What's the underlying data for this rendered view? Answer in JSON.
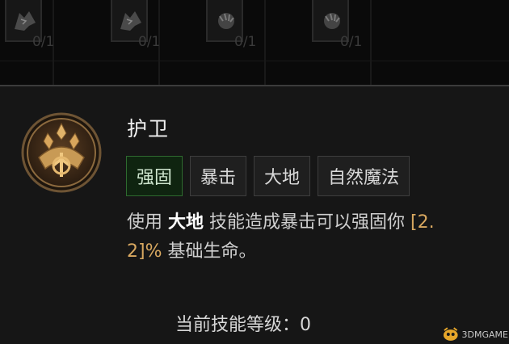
{
  "skill_bar": {
    "slots": [
      {
        "icon": "wolf-head-icon",
        "count": "0/1"
      },
      {
        "icon": "wolf-head-icon",
        "count": "0/1"
      },
      {
        "icon": "beast-claw-icon",
        "count": "0/1"
      },
      {
        "icon": "beast-claw-icon",
        "count": "0/1"
      }
    ]
  },
  "tooltip": {
    "emblem_icon": "earth-crystal-emblem-icon",
    "title": "护卫",
    "tags": [
      "强固",
      "暴击",
      "大地",
      "自然魔法"
    ],
    "description": {
      "prefix": "使用 ",
      "keyword": "大地",
      "middle": " 技能造成暴击可以强固你 ",
      "value_part1": "[2.",
      "value_part2": "2]%",
      "suffix": " 基础生命。"
    },
    "rank_label": "当前技能等级：0"
  },
  "watermark": {
    "text": "3DMGAME"
  },
  "colors": {
    "background": "#161616",
    "active_tag": "#2e6a2f",
    "value_highlight": "#d8a860",
    "emblem_gold": "#c89a55"
  }
}
